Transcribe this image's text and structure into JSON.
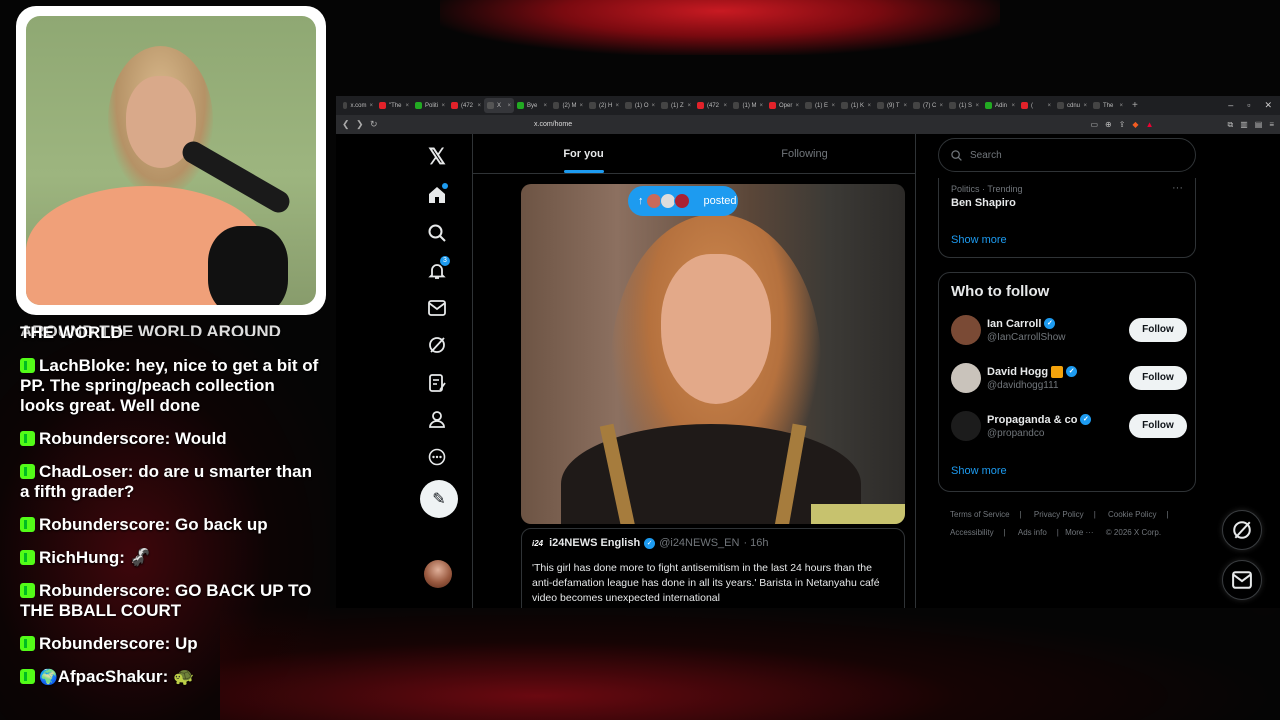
{
  "browser": {
    "tabs": [
      {
        "label": "x.com",
        "color": "#444"
      },
      {
        "label": "\"The",
        "color": "#e2222a"
      },
      {
        "label": "Politi",
        "color": "#2a2"
      },
      {
        "label": "(472",
        "color": "#e2222a"
      },
      {
        "label": "X",
        "color": "#555",
        "active": true
      },
      {
        "label": "Bye",
        "color": "#2a2"
      },
      {
        "label": "(2) M",
        "color": "#444"
      },
      {
        "label": "(2) H",
        "color": "#444"
      },
      {
        "label": "(1) O",
        "color": "#444"
      },
      {
        "label": "(1) Z",
        "color": "#444"
      },
      {
        "label": "(472",
        "color": "#e2222a"
      },
      {
        "label": "(1) M",
        "color": "#444"
      },
      {
        "label": "Oper",
        "color": "#e2222a"
      },
      {
        "label": "(1) E",
        "color": "#444"
      },
      {
        "label": "(1) K",
        "color": "#444"
      },
      {
        "label": "(9) T",
        "color": "#444"
      },
      {
        "label": "(7) C",
        "color": "#444"
      },
      {
        "label": "(1) S",
        "color": "#444"
      },
      {
        "label": "Adin",
        "color": "#2a2"
      },
      {
        "label": "(",
        "color": "#e2222a"
      },
      {
        "label": "cdnu",
        "color": "#444"
      },
      {
        "label": "The",
        "color": "#444"
      }
    ],
    "url": "x.com/home"
  },
  "chat": {
    "partial_line": "AROUND THE WORLD AROUND",
    "messages": [
      {
        "text": "THE WORLD",
        "continuation": true
      },
      {
        "user": "LachBloke",
        "text": "hey, nice to get a bit of PP. The spring/peach collection looks great. Well done"
      },
      {
        "user": "Robunderscore",
        "text": "Would"
      },
      {
        "user": "ChadLoser",
        "text": "do are u smarter than a fifth grader?"
      },
      {
        "user": "Robunderscore",
        "text": "Go back up"
      },
      {
        "user": "RichHung",
        "text": "🦨"
      },
      {
        "user": "Robunderscore",
        "text": "GO BACK UP TO THE BBALL COURT"
      },
      {
        "user": "Robunderscore",
        "text": "Up"
      },
      {
        "user": "AfpacShakur",
        "text": "🐢",
        "badge": "🌍"
      }
    ]
  },
  "feed": {
    "tab_for_you": "For you",
    "tab_following": "Following",
    "posted_label": "posted",
    "tweet": {
      "logo": "i24",
      "name": "i24NEWS English",
      "handle": "@i24NEWS_EN",
      "time": "· 16h",
      "body": "'This girl has done more to fight antisemitism in the last 24 hours than the anti-defamation league has done in all its years.' Barista in Netanyahu café video becomes unexpected international"
    }
  },
  "nav": {
    "notification_count": "3"
  },
  "sidebar": {
    "search_placeholder": "Search",
    "trend_category": "Politics · Trending",
    "trend_name": "Ben Shapiro",
    "show_more": "Show more",
    "who_to_follow_title": "Who to follow",
    "follow_label": "Follow",
    "suggestions": [
      {
        "name": "Ian Carroll",
        "handle": "@IanCarrollShow",
        "color": "#7a4a35"
      },
      {
        "name": "David Hogg",
        "handle": "@davidhogg111",
        "color": "#c9c3bb"
      },
      {
        "name": "Propaganda & co",
        "handle": "@propandco",
        "color": "#1c1c1c"
      }
    ],
    "footer": {
      "terms": "Terms of Service",
      "privacy": "Privacy Policy",
      "cookie": "Cookie Policy",
      "accessibility": "Accessibility",
      "ads": "Ads info",
      "more": "More ···",
      "copyright": "© 2026 X Corp."
    }
  }
}
